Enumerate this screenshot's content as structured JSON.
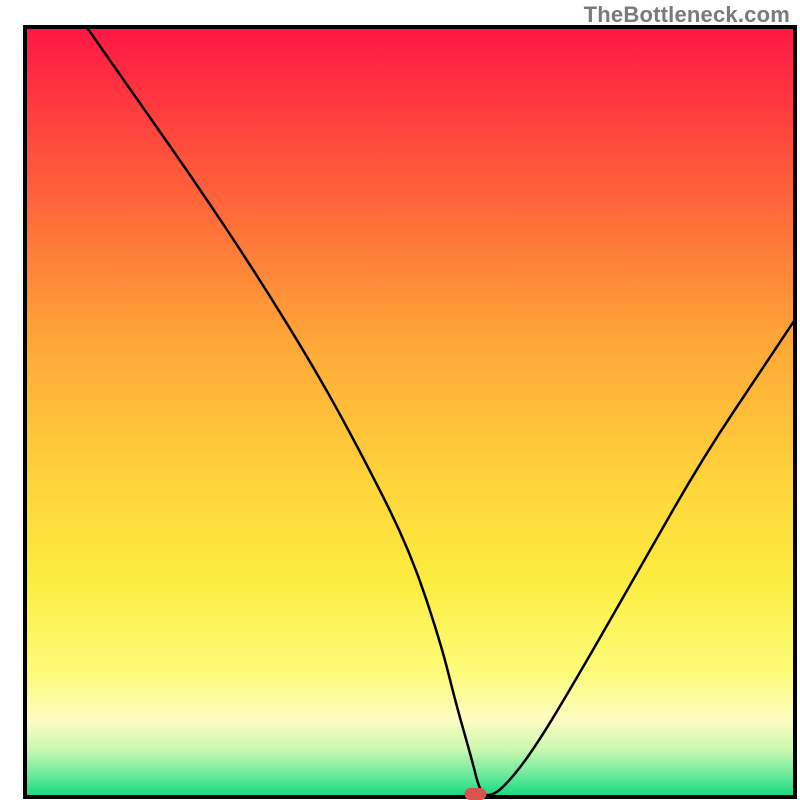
{
  "watermark": "TheBottleneck.com",
  "chart_data": {
    "type": "line",
    "title": "",
    "xlabel": "",
    "ylabel": "",
    "xlim": [
      0,
      100
    ],
    "ylim": [
      0,
      100
    ],
    "x": [
      8,
      15,
      22,
      30,
      38,
      44,
      50,
      54,
      56,
      58,
      59,
      60,
      62,
      66,
      72,
      80,
      88,
      96,
      100
    ],
    "y": [
      100,
      90,
      80,
      68,
      55,
      44,
      32,
      20,
      12,
      5,
      1,
      0,
      1,
      6,
      16,
      30,
      44,
      56,
      62
    ],
    "flat_segment": {
      "x0": 56,
      "x1": 60,
      "y": 0
    },
    "marker": {
      "x": 58.5,
      "y": 0,
      "color": "#d9534f"
    },
    "background": {
      "type": "vertical-gradient",
      "stops": [
        {
          "offset": 0.0,
          "color": "#ff1744"
        },
        {
          "offset": 0.2,
          "color": "#ff5c3a"
        },
        {
          "offset": 0.4,
          "color": "#ffa437"
        },
        {
          "offset": 0.58,
          "color": "#ffd23a"
        },
        {
          "offset": 0.72,
          "color": "#fced3f"
        },
        {
          "offset": 0.84,
          "color": "#fdfc7b"
        },
        {
          "offset": 0.9,
          "color": "#fdfdc2"
        },
        {
          "offset": 0.94,
          "color": "#c8f7b0"
        },
        {
          "offset": 0.975,
          "color": "#5fe89a"
        },
        {
          "offset": 1.0,
          "color": "#13d67c"
        }
      ]
    },
    "frame": {
      "stroke": "#000000",
      "width": 4
    },
    "curve_stroke": {
      "color": "#000000",
      "width": 2.5
    }
  }
}
